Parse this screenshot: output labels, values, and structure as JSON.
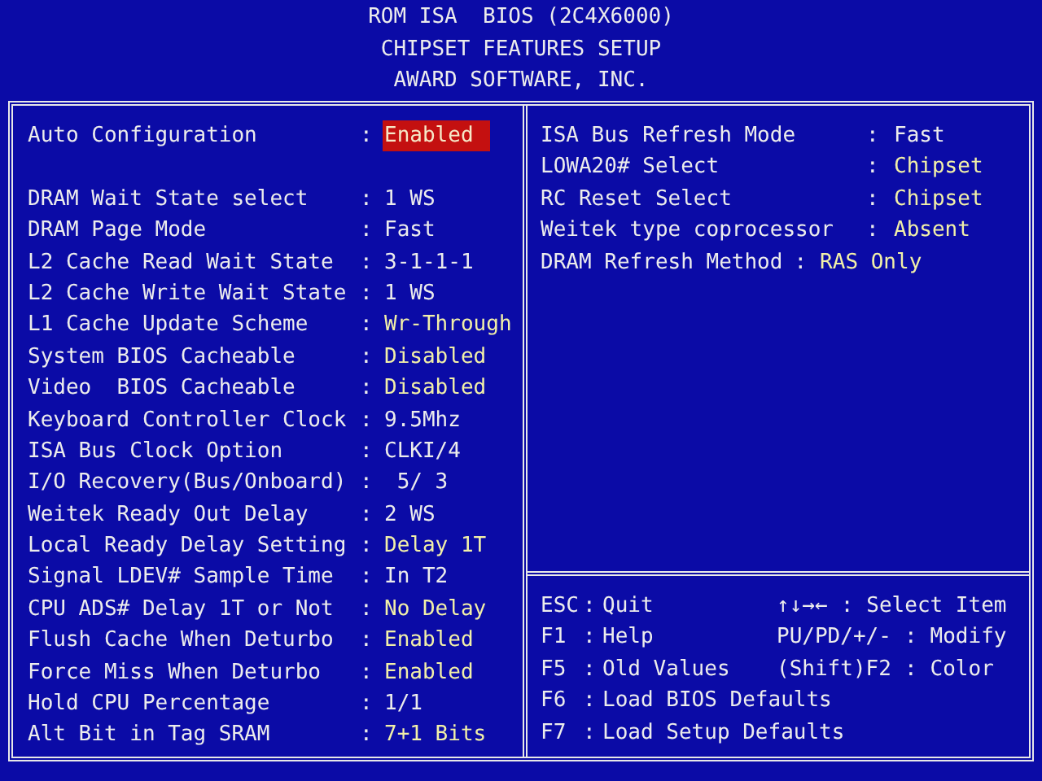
{
  "header": {
    "lines": [
      "ROM ISA  BIOS (2C4X6000)",
      "CHIPSET FEATURES SETUP",
      "AWARD SOFTWARE, INC."
    ]
  },
  "left_settings": [
    {
      "kind": "setting",
      "label": "Auto Configuration",
      "separator": ":",
      "value": "Enabled",
      "selected": true,
      "emphasized": false
    },
    {
      "kind": "blank"
    },
    {
      "kind": "setting",
      "label": "DRAM Wait State select",
      "separator": ":",
      "value": "1 WS",
      "selected": false,
      "emphasized": false
    },
    {
      "kind": "setting",
      "label": "DRAM Page Mode",
      "separator": ":",
      "value": "Fast",
      "selected": false,
      "emphasized": false
    },
    {
      "kind": "setting",
      "label": "L2 Cache Read Wait State",
      "separator": ":",
      "value": "3-1-1-1",
      "selected": false,
      "emphasized": false
    },
    {
      "kind": "setting",
      "label": "L2 Cache Write Wait State",
      "separator": ":",
      "value": "1 WS",
      "selected": false,
      "emphasized": false
    },
    {
      "kind": "setting",
      "label": "L1 Cache Update Scheme",
      "separator": ":",
      "value": "Wr-Through",
      "selected": false,
      "emphasized": true
    },
    {
      "kind": "setting",
      "label": "System BIOS Cacheable",
      "separator": ":",
      "value": "Disabled",
      "selected": false,
      "emphasized": true
    },
    {
      "kind": "setting",
      "label": "Video  BIOS Cacheable",
      "separator": ":",
      "value": "Disabled",
      "selected": false,
      "emphasized": true
    },
    {
      "kind": "setting",
      "label": "Keyboard Controller Clock",
      "separator": ":",
      "value": "9.5Mhz",
      "selected": false,
      "emphasized": false
    },
    {
      "kind": "setting",
      "label": "ISA Bus Clock Option",
      "separator": ":",
      "value": "CLKI/4",
      "selected": false,
      "emphasized": false
    },
    {
      "kind": "setting",
      "label": "I/O Recovery(Bus/Onboard)",
      "separator": ":",
      "value": " 5/ 3",
      "selected": false,
      "emphasized": false
    },
    {
      "kind": "setting",
      "label": "Weitek Ready Out Delay",
      "separator": ":",
      "value": "2 WS",
      "selected": false,
      "emphasized": false
    },
    {
      "kind": "setting",
      "label": "Local Ready Delay Setting",
      "separator": ":",
      "value": "Delay 1T",
      "selected": false,
      "emphasized": true
    },
    {
      "kind": "setting",
      "label": "Signal LDEV# Sample Time",
      "separator": ":",
      "value": "In T2",
      "selected": false,
      "emphasized": false
    },
    {
      "kind": "setting",
      "label": "CPU ADS# Delay 1T or Not",
      "separator": ":",
      "value": "No Delay",
      "selected": false,
      "emphasized": true
    },
    {
      "kind": "setting",
      "label": "Flush Cache When Deturbo",
      "separator": ":",
      "value": "Enabled",
      "selected": false,
      "emphasized": true
    },
    {
      "kind": "setting",
      "label": "Force Miss When Deturbo",
      "separator": ":",
      "value": "Enabled",
      "selected": false,
      "emphasized": true
    },
    {
      "kind": "setting",
      "label": "Hold CPU Percentage",
      "separator": ":",
      "value": "1/1",
      "selected": false,
      "emphasized": false
    },
    {
      "kind": "setting",
      "label": "Alt Bit in Tag SRAM",
      "separator": ":",
      "value": "7+1 Bits",
      "selected": false,
      "emphasized": true
    }
  ],
  "right_settings": [
    {
      "kind": "aligned",
      "label": "ISA Bus Refresh Mode",
      "separator": ":",
      "value": "Fast",
      "selected": false,
      "emphasized": false
    },
    {
      "kind": "aligned",
      "label": "LOWA20# Select",
      "separator": ":",
      "value": "Chipset",
      "selected": false,
      "emphasized": true
    },
    {
      "kind": "aligned",
      "label": "RC Reset Select",
      "separator": ":",
      "value": "Chipset",
      "selected": false,
      "emphasized": true
    },
    {
      "kind": "aligned",
      "label": "Weitek type coprocessor",
      "separator": ":",
      "value": "Absent",
      "selected": false,
      "emphasized": true
    },
    {
      "kind": "inline",
      "label": "DRAM Refresh Method",
      "separator": ":",
      "value": "RAS Only",
      "selected": false,
      "emphasized": true
    }
  ],
  "help": {
    "keys": [
      {
        "key": "ESC",
        "separator": ":",
        "action": "Quit"
      },
      {
        "key": "F1",
        "separator": ":",
        "action": "Help"
      },
      {
        "key": "F5",
        "separator": ":",
        "action": "Old Values"
      },
      {
        "key": "F6",
        "separator": ":",
        "action": "Load BIOS Defaults"
      },
      {
        "key": "F7",
        "separator": ":",
        "action": "Load Setup Defaults"
      }
    ],
    "navigation": [
      {
        "key": "↑↓→←",
        "separator": ":",
        "action": "Select Item"
      },
      {
        "key": "PU/PD/+/-",
        "separator": ":",
        "action": "Modify"
      },
      {
        "key": "(Shift)F2",
        "separator": ":",
        "action": "Color"
      }
    ]
  }
}
